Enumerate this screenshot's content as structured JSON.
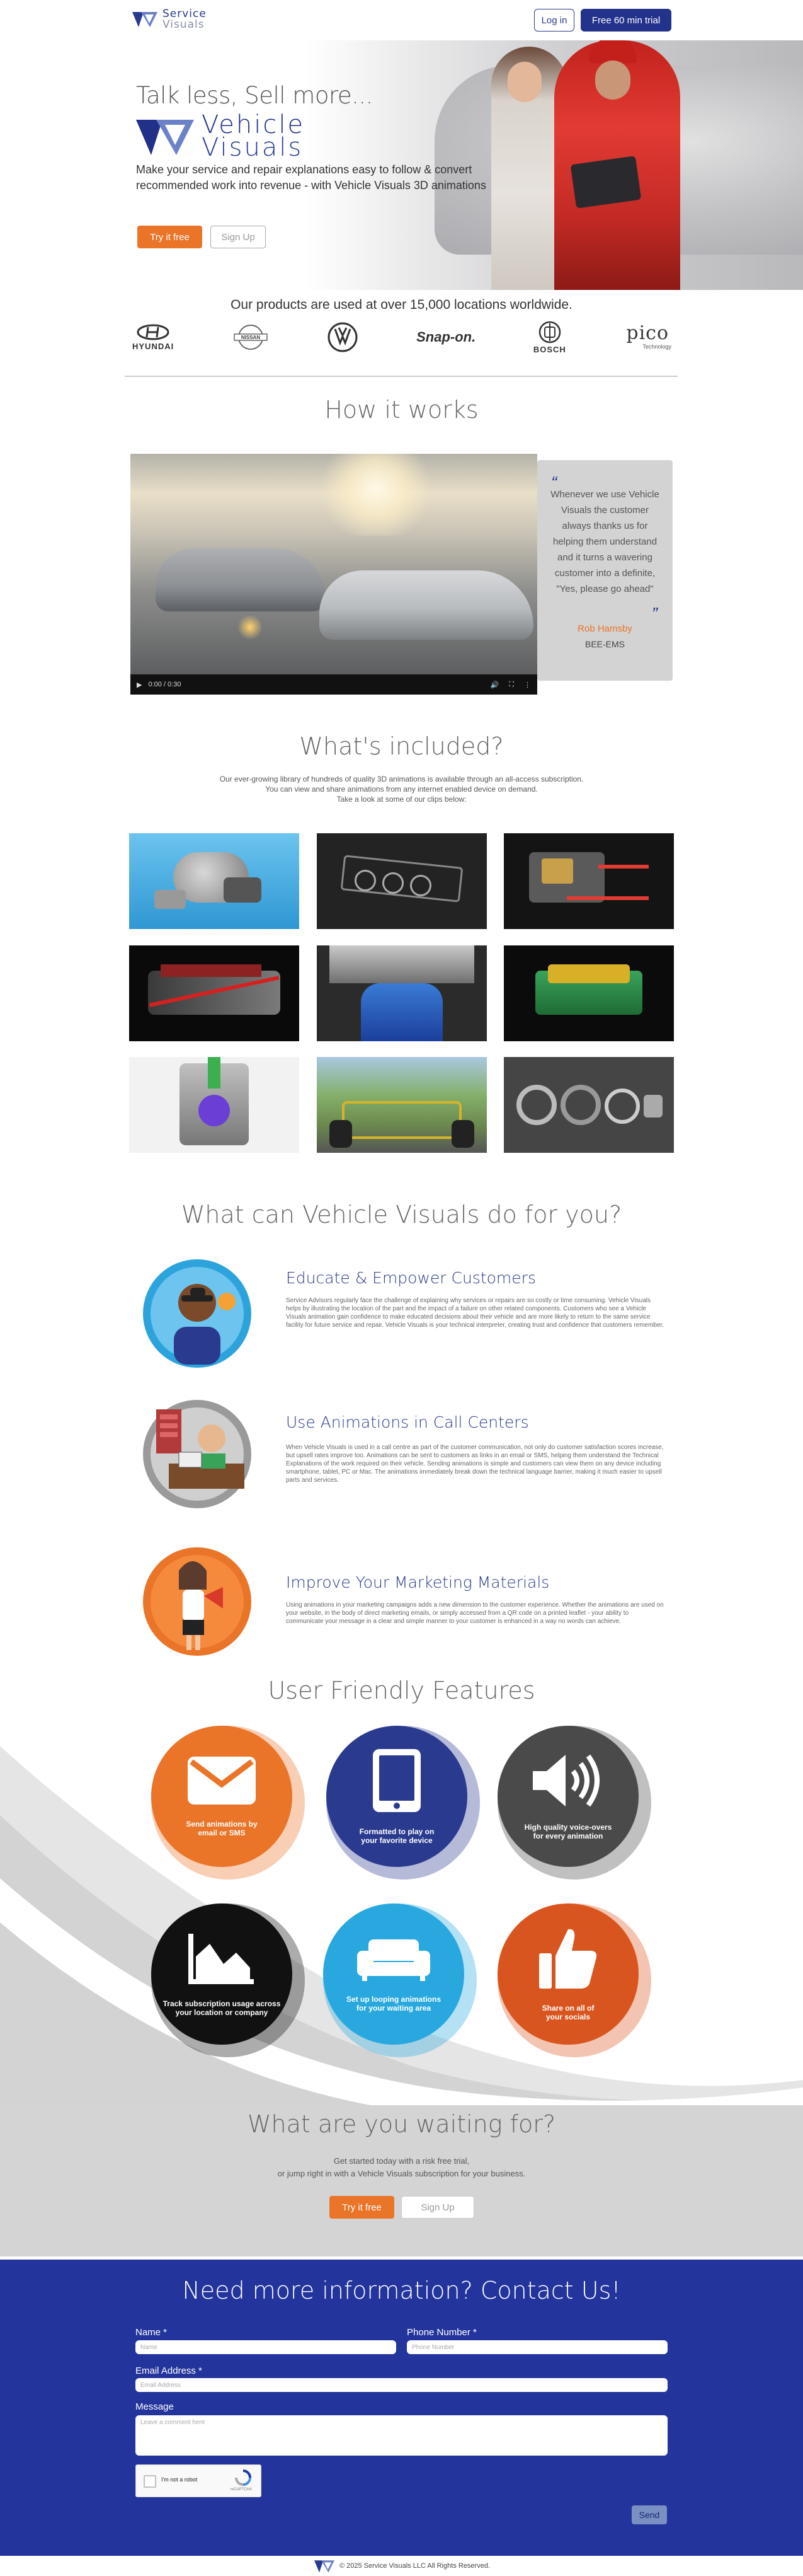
{
  "header": {
    "logo_line1": "Service",
    "logo_line2": "Visuals",
    "login_label": "Log in",
    "trial_label": "Free 60 min trial"
  },
  "hero": {
    "tagline": "Talk less, Sell more...",
    "logo_line1": "Vehicle",
    "logo_line2": "Visuals",
    "description": "Make your service and repair explanations easy to follow & convert recommended work into revenue - with Vehicle Visuals 3D animations",
    "try_label": "Try it free",
    "signup_label": "Sign Up"
  },
  "brands": {
    "title": "Our products are used at over 15,000 locations worldwide.",
    "items": [
      {
        "name": "HYUNDAI",
        "icon": "hyundai-logo"
      },
      {
        "name": "NISSAN",
        "icon": "nissan-logo"
      },
      {
        "name": "",
        "icon": "vw-logo"
      },
      {
        "name": "Snap-on.",
        "icon": "snapon-logo"
      },
      {
        "name": "BOSCH",
        "icon": "bosch-logo"
      },
      {
        "name": "pico",
        "icon": "pico-logo",
        "sub": "Technology"
      }
    ]
  },
  "how_it_works": {
    "title": "How it works",
    "video_time": "0:00 / 0:30",
    "testimonial": {
      "quote": "Whenever we use Vehicle Visuals the customer always thanks us for helping them understand and it turns a wavering customer into a definite, \"Yes, please go ahead\"",
      "author": "Rob Hamsby",
      "company": "BEE-EMS"
    }
  },
  "included": {
    "title": "What's included?",
    "description_lines": [
      "Our ever-growing library of hundreds of quality 3D animations is available through an all-access subscription.",
      "You can view and share animations from any internet enabled device on demand.",
      "Take a look at some of our clips below:"
    ]
  },
  "what_can_do": {
    "title": "What can Vehicle Visuals do for you?",
    "features": [
      {
        "title": "Educate & Empower Customers",
        "body": "Service Advisors regularly face the challenge of explaining why services or repairs are so costly or time consuming. Vehicle Visuals helps by illustrating the location of the part and the impact of a failure on other related components. Customers who see a Vehicle Visuals animation gain confidence to make educated decisions about their vehicle and are more likely to return to the same service facility for future service and repair. Vehicle Visuals is your technical interpreter, creating trust and confidence that customers remember."
      },
      {
        "title": "Use Animations in Call Centers",
        "body": "When Vehicle Visuals is used in a call centre as part of the customer communication, not only do customer satisfaction scores increase, but upsell rates improve too. Animations can be sent to customers as links in an email or SMS, helping them understand the Technical Explanations of the work required on their vehicle. Sending animations is simple and customers can view them on any device including smartphone, tablet, PC or Mac. The animations immediately break down the technical language barrier, making it much easier to upsell parts and services."
      },
      {
        "title": "Improve Your Marketing Materials",
        "body": "Using animations in your marketing campaigns adds a new dimension to the customer experience. Whether the animations are used on your website, in the body of direct marketing emails, or simply accessed from a QR code on a printed leaflet - your ability to communicate your message in a clear and simple manner to your customer is enhanced in a way no words can achieve."
      }
    ]
  },
  "user_friendly": {
    "title": "User Friendly Features",
    "items": [
      {
        "label_line1": "Send animations by",
        "label_line2": "email or SMS",
        "icon": "envelope-icon",
        "color": "#ea7428"
      },
      {
        "label_line1": "Formatted to play on",
        "label_line2": "your favorite device",
        "icon": "tablet-icon",
        "color": "#2a3a8f"
      },
      {
        "label_line1": "High quality voice-overs",
        "label_line2": "for every animation",
        "icon": "speaker-icon",
        "color": "#4a4a4a"
      },
      {
        "label_line1": "Track subscription usage across",
        "label_line2": "your location or company",
        "icon": "area-chart-icon",
        "color": "#111111"
      },
      {
        "label_line1": "Set up looping animations",
        "label_line2": "for your waiting area",
        "icon": "couch-icon",
        "color": "#29a8e0"
      },
      {
        "label_line1": "Share on all of",
        "label_line2": "your socials",
        "icon": "thumbs-up-icon",
        "color": "#d9551f"
      }
    ]
  },
  "waiting": {
    "title": "What are you waiting for?",
    "line1": "Get started today with a risk free trial,",
    "line2": "or jump right in with a Vehicle Visuals subscription for your business.",
    "try_label": "Try it free",
    "signup_label": "Sign Up"
  },
  "contact": {
    "title": "Need more information? Contact Us!",
    "name_label": "Name *",
    "name_placeholder": "Name",
    "phone_label": "Phone Number *",
    "phone_placeholder": "Phone Number",
    "email_label": "Email Address *",
    "email_placeholder": "Email Address",
    "message_label": "Message",
    "message_placeholder": "Leave a comment here",
    "captcha_label": "I'm not a robot",
    "captcha_brand": "reCAPTCHA",
    "send_label": "Send"
  },
  "footer": {
    "copyright": "© 2025 Service Visuals LLC All Rights Reserved."
  }
}
